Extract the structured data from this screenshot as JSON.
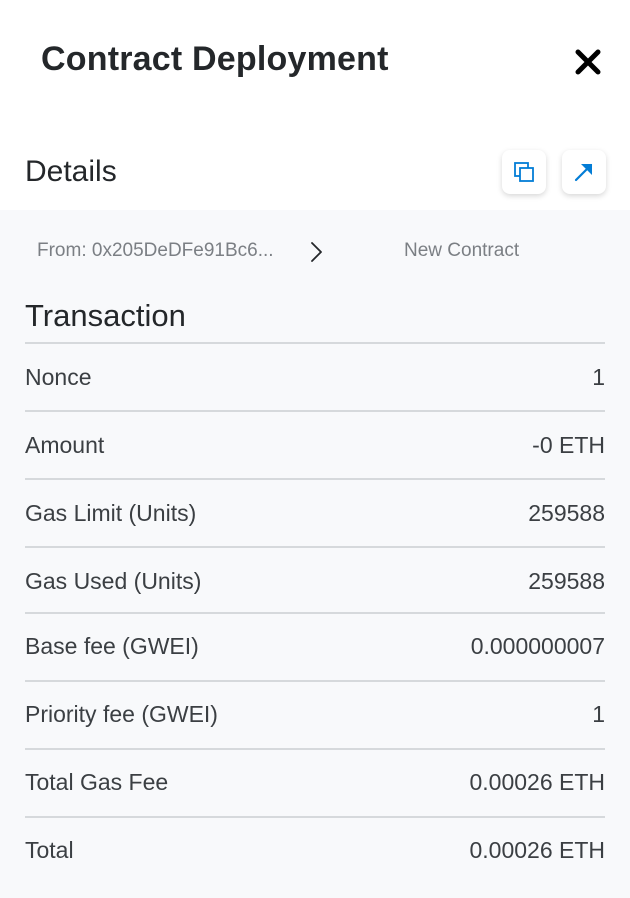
{
  "header": {
    "title": "Contract Deployment",
    "close_icon": "close-icon"
  },
  "details": {
    "title": "Details",
    "copy_icon": "copy-icon",
    "explorer_icon": "external-link-icon"
  },
  "transfer": {
    "from": "From: 0x205DeDFe91Bc6...",
    "to": "New Contract",
    "arrow_icon": "chevron-right-icon"
  },
  "transaction": {
    "title": "Transaction",
    "rows": [
      {
        "label": "Nonce",
        "value": "1"
      },
      {
        "label": "Amount",
        "value": "-0 ETH"
      },
      {
        "label": "Gas Limit (Units)",
        "value": "259588"
      },
      {
        "label": "Gas Used (Units)",
        "value": "259588"
      },
      {
        "label": "Base fee (GWEI)",
        "value": "0.000000007"
      },
      {
        "label": "Priority fee (GWEI)",
        "value": "1"
      },
      {
        "label": "Total Gas Fee",
        "value": "0.00026 ETH"
      },
      {
        "label": "Total",
        "value": "0.00026 ETH"
      }
    ]
  },
  "colors": {
    "text": "#24272a",
    "muted": "#7b7f84",
    "divider": "#d6d9dc",
    "panel": "#f8f9fb",
    "accent": "#037dd6"
  }
}
